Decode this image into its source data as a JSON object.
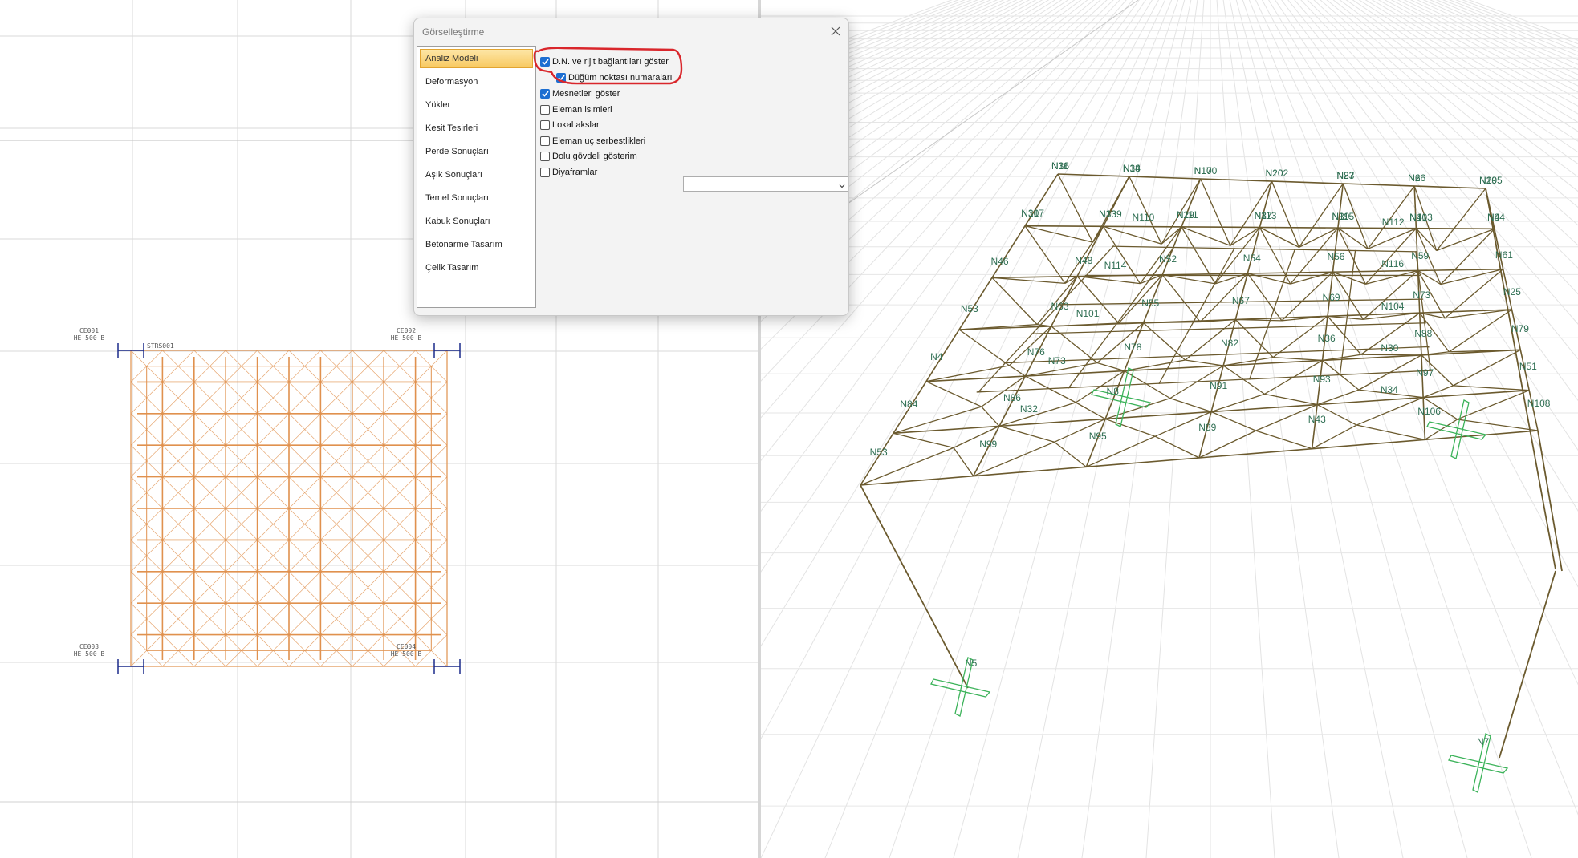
{
  "plan_view": {
    "column_labels": [
      {
        "name": "CE001",
        "section": "HE 500 B"
      },
      {
        "name": "CE002",
        "section": "HE 500 B"
      },
      {
        "name": "CE003",
        "section": "HE 500 B"
      },
      {
        "name": "CE004",
        "section": "HE 500 B"
      }
    ],
    "truss_label": "STRS001"
  },
  "dialog": {
    "title": "Görselleştirme",
    "categories": [
      {
        "label": "Analiz Modeli",
        "active": true
      },
      {
        "label": "Deformasyon"
      },
      {
        "label": "Yükler"
      },
      {
        "label": "Kesit Tesirleri"
      },
      {
        "label": "Perde Sonuçları"
      },
      {
        "label": "Aşık Sonuçları"
      },
      {
        "label": "Temel Sonuçları"
      },
      {
        "label": "Kabuk Sonuçları"
      },
      {
        "label": "Betonarme Tasarım"
      },
      {
        "label": "Çelik Tasarım"
      }
    ],
    "options": [
      {
        "label": "D.N. ve rijit bağlantıları göster",
        "checked": true
      },
      {
        "label": "Düğüm noktası numaraları",
        "checked": true
      },
      {
        "label": "Mesnetleri göster",
        "checked": true
      },
      {
        "label": "Eleman isimleri",
        "checked": false
      },
      {
        "label": "Lokal akslar",
        "checked": false
      },
      {
        "label": "Eleman uç serbestlikleri",
        "checked": false
      },
      {
        "label": "Dolu gövdeli gösterim",
        "checked": false
      },
      {
        "label": "Diyaframlar",
        "checked": false
      }
    ],
    "diaphragm_select_value": "",
    "highlight_color": "#d9262b"
  },
  "model_view": {
    "member_color": "#6b5a2e",
    "label_color": "#2e6e52",
    "support_color": "#3cb35a",
    "node_labels": [
      "N11",
      "N14",
      "N17",
      "N20",
      "N23",
      "N26",
      "N29",
      "N31",
      "N33",
      "N29",
      "N37",
      "N39",
      "N41",
      "N44",
      "N46",
      "N48",
      "N52",
      "N54",
      "N56",
      "N59",
      "N61",
      "N53",
      "N63",
      "N55",
      "N67",
      "N69",
      "N73",
      "N25",
      "N4",
      "N76",
      "N78",
      "N82",
      "N36",
      "N88",
      "N79",
      "N84",
      "N86",
      "N8",
      "N91",
      "N93",
      "N97",
      "N51",
      "N53",
      "N99",
      "N95",
      "N89",
      "N43",
      "N106",
      "N108",
      "N110",
      "N112",
      "N114",
      "N116",
      "N101",
      "N104",
      "N73",
      "N30",
      "N32",
      "N34",
      "N36",
      "N38",
      "N100",
      "N102",
      "N87",
      "N6",
      "N105",
      "N107",
      "N109",
      "N111",
      "N113",
      "N115",
      "N103",
      "N8",
      "N5",
      "N7"
    ]
  }
}
